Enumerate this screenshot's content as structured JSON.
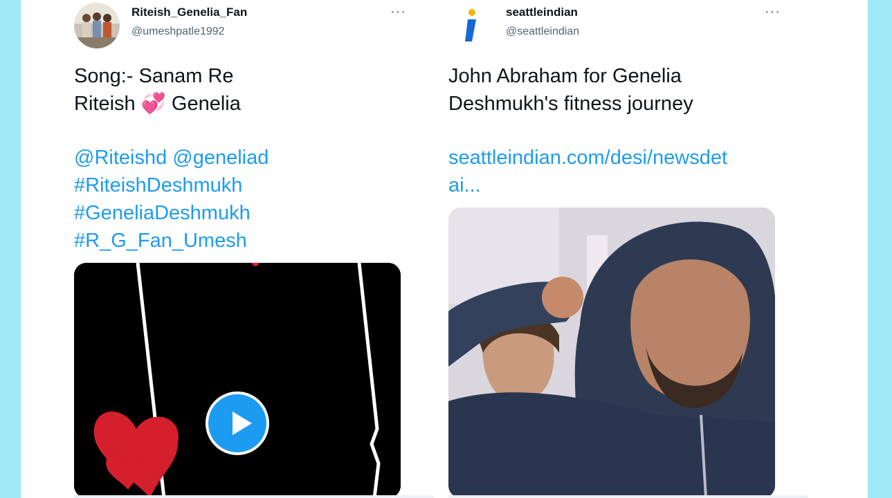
{
  "tweets": [
    {
      "name": "Riteish_Genelia_Fan",
      "handle": "@umeshpatle1992",
      "more": "···",
      "line1": "Song:- Sanam Re",
      "line2_a": "Riteish",
      "line2_emoji": "💞",
      "line2_b": "Genelia",
      "mentions": "@Riteishd @geneliad",
      "hashtag1": "#RiteishDeshmukh",
      "hashtag2": "#GeneliaDeshmukh",
      "hashtag3": "#R_G_Fan_Umesh",
      "media_type": "video",
      "play_icon": "play-icon"
    },
    {
      "name": "seattleindian",
      "handle": "@seattleindian",
      "more": "···",
      "line1": "John Abraham for Genelia",
      "line2": "Deshmukh's fitness journey",
      "link_line1": "seattleindian.com/desi/newsdet",
      "link_line2": "ai...",
      "avatar_glyph": "i",
      "media_type": "image"
    }
  ],
  "colors": {
    "background": "#9ee8f8",
    "link": "#1d9bf0",
    "text": "#0f1419",
    "muted": "#536471"
  }
}
